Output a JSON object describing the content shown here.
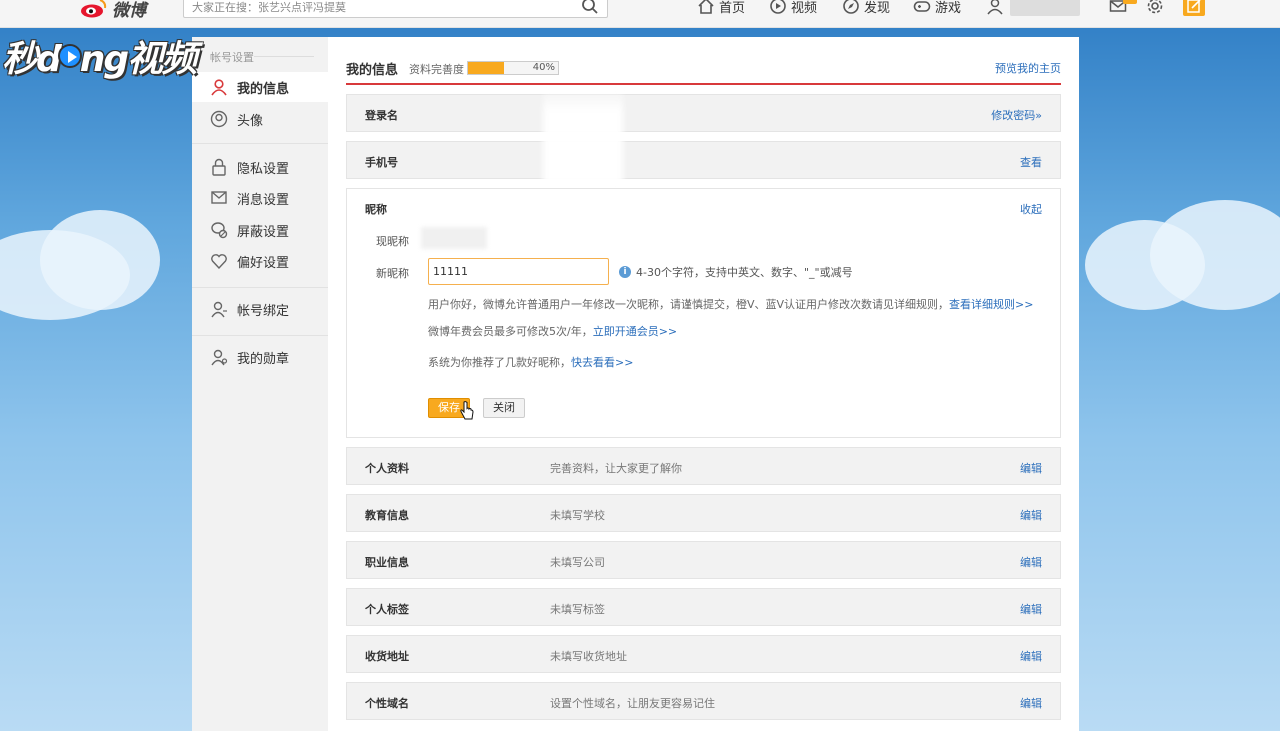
{
  "topbar": {
    "logo_text": "微博",
    "search_placeholder": "大家正在搜：张艺兴点评冯提莫",
    "nav": [
      {
        "label": "首页",
        "icon": "home-icon"
      },
      {
        "label": "视频",
        "icon": "video-icon"
      },
      {
        "label": "发现",
        "icon": "discover-icon"
      },
      {
        "label": "游戏",
        "icon": "game-icon"
      }
    ]
  },
  "watermark": {
    "part1": "秒d",
    "part2": "ng视频"
  },
  "sidebar": {
    "title": "帐号设置",
    "items": [
      {
        "label": "我的信息",
        "icon": "user-icon"
      },
      {
        "label": "头像",
        "icon": "avatar-icon"
      },
      {
        "label": "隐私设置",
        "icon": "lock-icon"
      },
      {
        "label": "消息设置",
        "icon": "message-icon"
      },
      {
        "label": "屏蔽设置",
        "icon": "block-icon"
      },
      {
        "label": "偏好设置",
        "icon": "heart-icon"
      },
      {
        "label": "帐号绑定",
        "icon": "bind-icon"
      },
      {
        "label": "我的勋章",
        "icon": "medal-icon"
      }
    ]
  },
  "main": {
    "title": "我的信息",
    "progress_label": "资料完善度",
    "progress_value": 40,
    "progress_text": "40%",
    "preview_link": "预览我的主页",
    "rows_top": [
      {
        "label": "登录名",
        "value": "",
        "action": "修改密码»"
      },
      {
        "label": "手机号",
        "value": "",
        "action": "查看"
      }
    ],
    "nickname": {
      "label": "昵称",
      "action": "收起",
      "current_label": "现昵称",
      "new_label": "新昵称",
      "input_value": "11111",
      "hint": "4-30个字符，支持中英文、数字、\"_\"或减号",
      "para1": "用户你好，微博允许普通用户一年修改一次昵称，请谨慎提交，橙V、蓝V认证用户修改次数请见详细规则，",
      "para1_link": "查看详细规则>>",
      "para2": "微博年费会员最多可修改5次/年，",
      "para2_link": "立即开通会员>>",
      "para3": "系统为你推荐了几款好昵称，",
      "para3_link": "快去看看>>",
      "save_label": "保存",
      "close_label": "关闭"
    },
    "rows_bottom": [
      {
        "label": "个人资料",
        "value": "完善资料，让大家更了解你",
        "action": "编辑"
      },
      {
        "label": "教育信息",
        "value": "未填写学校",
        "action": "编辑"
      },
      {
        "label": "职业信息",
        "value": "未填写公司",
        "action": "编辑"
      },
      {
        "label": "个人标签",
        "value": "未填写标签",
        "action": "编辑"
      },
      {
        "label": "收货地址",
        "value": "未填写收货地址",
        "action": "编辑"
      },
      {
        "label": "个性域名",
        "value": "设置个性域名，让朋友更容易记住",
        "action": "编辑"
      }
    ]
  },
  "colors": {
    "accent": "#f8a91f",
    "link": "#2b6ebb",
    "divider": "#d8393b"
  }
}
